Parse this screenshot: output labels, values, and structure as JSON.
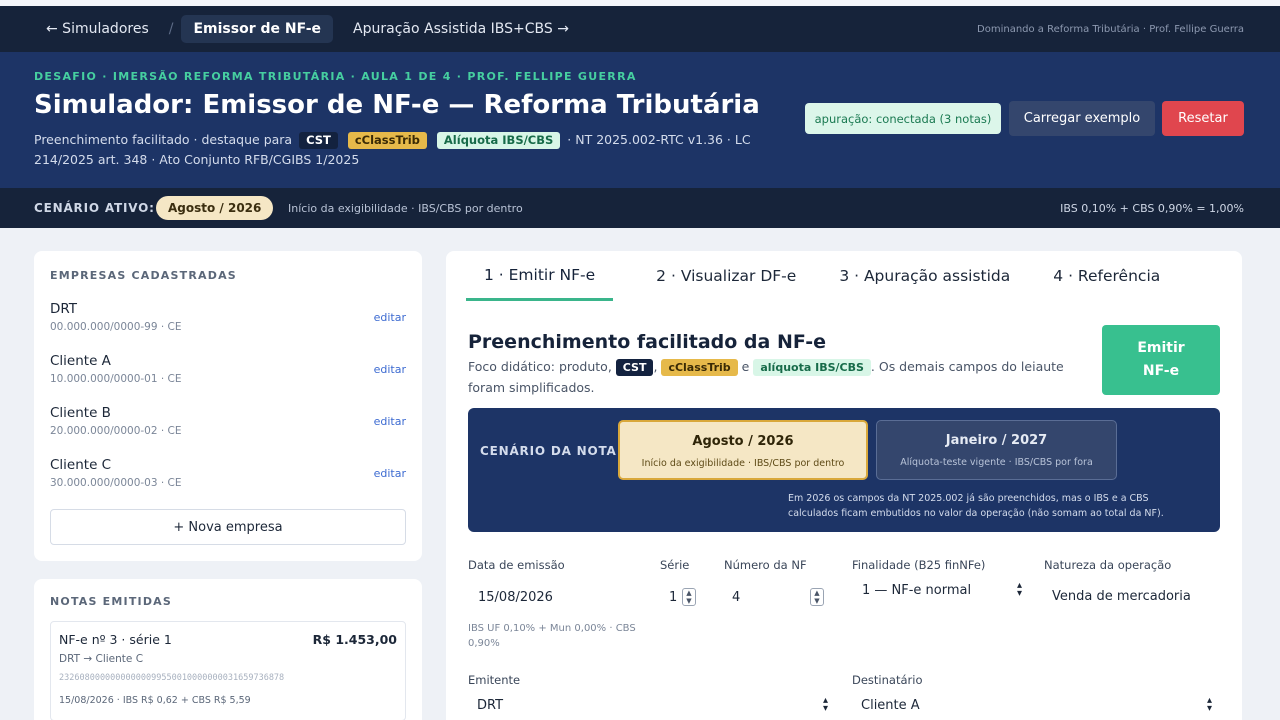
{
  "topbar": {
    "back_link": "← Simuladores",
    "separator": "/",
    "current": "Emissor de NF-e",
    "next_link": "Apuração Assistida IBS+CBS →",
    "credit": "Dominando a Reforma Tributária · Prof. Fellipe Guerra"
  },
  "hero": {
    "eyebrow": "DESAFIO · IMERSÃO REFORMA TRIBUTÁRIA · AULA 1 DE 4 · PROF. FELLIPE GUERRA",
    "title": "Simulador: Emissor de NF-e — Reforma Tributária",
    "subtitle_prefix": "Preenchimento facilitado · destaque para",
    "pill_cst": "CST",
    "pill_cclass": "cClassTrib",
    "pill_aliq": "Alíquota IBS/CBS",
    "subtitle_suffix": "· NT 2025.002-RTC v1.36 · LC 214/2025 art. 348 · Ato Conjunto RFB/CGIBS 1/2025",
    "status_chip": "apuração: conectada (3 notas)",
    "load_button": "Carregar exemplo",
    "reset_button": "Resetar"
  },
  "scenario_bar": {
    "label": "CENÁRIO ATIVO:",
    "badge": "Agosto / 2026",
    "description": "Início da exigibilidade · IBS/CBS por dentro",
    "rate": "IBS 0,10% + CBS 0,90% = 1,00%"
  },
  "companies": {
    "header": "EMPRESAS CADASTRADAS",
    "edit_label": "editar",
    "items": [
      {
        "name": "DRT",
        "doc": "00.000.000/0000-99 · CE"
      },
      {
        "name": "Cliente A",
        "doc": "10.000.000/0000-01 · CE"
      },
      {
        "name": "Cliente B",
        "doc": "20.000.000/0000-02 · CE"
      },
      {
        "name": "Cliente C",
        "doc": "30.000.000/0000-03 · CE"
      }
    ],
    "new_button": "+ Nova empresa"
  },
  "notes": {
    "header": "NOTAS EMITIDAS",
    "items": [
      {
        "title": "NF-e nº 3 · série 1",
        "value": "R$ 1.453,00",
        "parties": "DRT → Cliente C",
        "key": "23260800000000000099550010000000031659736878",
        "taxes": "15/08/2026 · IBS R$ 0,62 + CBS R$ 5,59"
      }
    ]
  },
  "tabs": [
    {
      "label": "1 · Emitir NF-e",
      "active": true
    },
    {
      "label": "2 · Visualizar DF-e",
      "active": false
    },
    {
      "label": "3 · Apuração assistida",
      "active": false
    },
    {
      "label": "4 · Referência",
      "active": false
    }
  ],
  "emit": {
    "title": "Preenchimento facilitado da NF-e",
    "desc_prefix": "Foco didático: produto,",
    "pill_cst": "CST",
    "pill_cclass": "cClassTrib",
    "desc_and": "e",
    "pill_aliq": "alíquota IBS/CBS",
    "desc_suffix": ". Os demais campos do leiaute foram simplificados.",
    "emit_button": "Emitir NF-e"
  },
  "scenario_panel": {
    "label": "CENÁRIO DA NOTA",
    "options": [
      {
        "title": "Agosto / 2026",
        "desc": "Início da exigibilidade · IBS/CBS por dentro",
        "selected": true
      },
      {
        "title": "Janeiro / 2027",
        "desc": "Alíquota-teste vigente · IBS/CBS por fora",
        "selected": false
      }
    ],
    "note": "Em 2026 os campos da NT 2025.002 já são preenchidos, mas o IBS e a CBS calculados ficam embutidos no valor da operação (não somam ao total da NF)."
  },
  "form": {
    "date_label": "Data de emissão",
    "date_value": "15/08/2026",
    "date_hint": "IBS UF 0,10% + Mun 0,00% · CBS 0,90%",
    "serie_label": "Série",
    "serie_value": "1",
    "number_label": "Número da NF",
    "number_value": "4",
    "purpose_label": "Finalidade (B25 finNFe)",
    "purpose_value": "1 — NF-e normal",
    "nature_label": "Natureza da operação",
    "nature_value": "Venda de mercadoria",
    "issuer_label": "Emitente",
    "issuer_value": "DRT",
    "recipient_label": "Destinatário",
    "recipient_value": "Cliente A"
  }
}
